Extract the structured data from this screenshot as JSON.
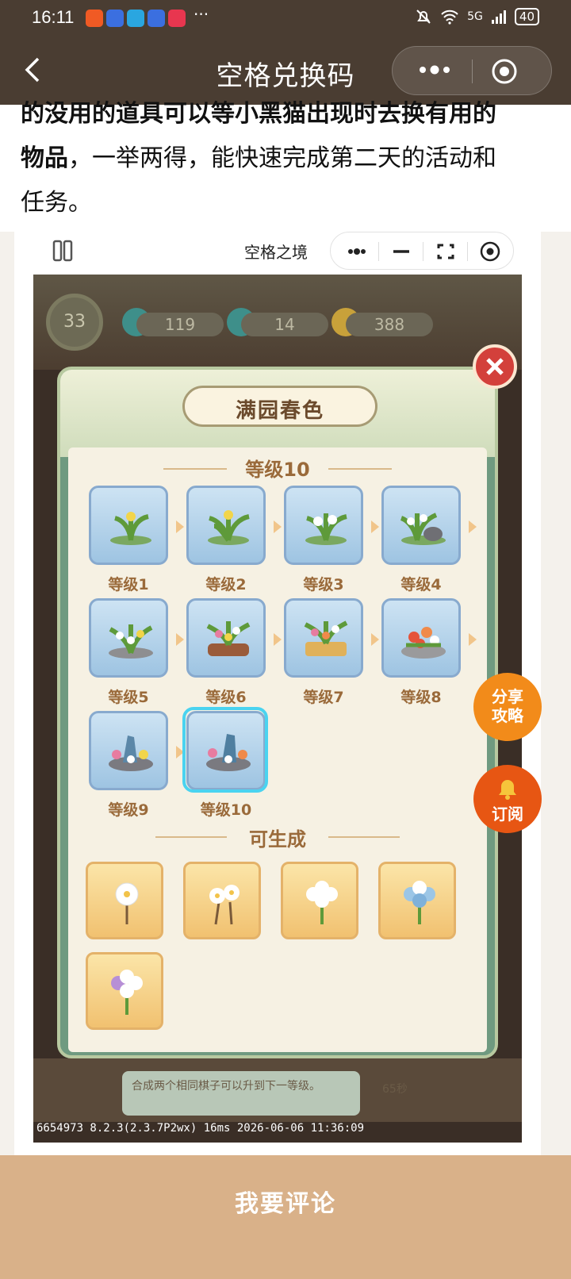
{
  "status": {
    "time": "16:11",
    "more": "···",
    "signal": "5G",
    "battery": "40"
  },
  "nav": {
    "title": "空格兑换码"
  },
  "article": {
    "line1": "的没用的道具可以等小黑猫出现时去换有用的",
    "line2_bold": "物品",
    "line2_rest": "，一举两得，能快速完成第二天的活动和",
    "line3": "任务。"
  },
  "embed": {
    "mini_title": "空格之境",
    "hud": {
      "level": "33",
      "res1": "119",
      "res2": "14",
      "res3": "388"
    },
    "popup": {
      "title": "满园春色",
      "section1": "等级10",
      "levels": [
        "等级1",
        "等级2",
        "等级3",
        "等级4",
        "等级5",
        "等级6",
        "等级7",
        "等级8",
        "等级9",
        "等级10"
      ],
      "section2": "可生成"
    },
    "hint": "合成两个相同棋子可以升到下一等级。",
    "timer": "65秒",
    "footer": "6654973 8.2.3(2.3.7P2wx) 16ms 2026-06-06 11:36:09"
  },
  "float": {
    "share": "分享\n攻略",
    "share_l1": "分享",
    "share_l2": "攻略",
    "subscribe": "订阅"
  },
  "bottom": {
    "comment": "我要评论"
  },
  "colors": {
    "bar": "#4a3d32",
    "accent_orange": "#f28b1a",
    "bottom": "#d9b189"
  }
}
